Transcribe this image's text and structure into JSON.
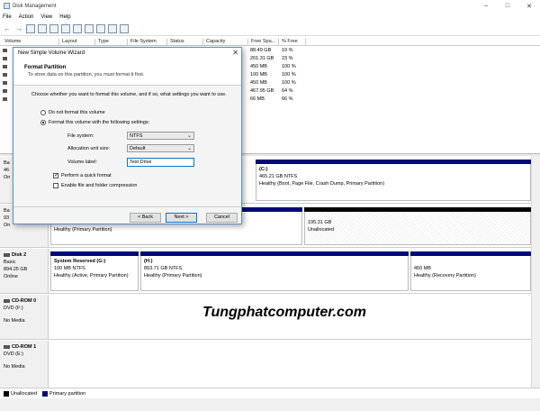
{
  "window": {
    "title": "Disk Management",
    "controls": [
      "–",
      "□",
      "✕"
    ]
  },
  "menu": [
    "File",
    "Action",
    "View",
    "Help"
  ],
  "toolbar": {
    "back_icon": "←",
    "forward_icon": "→"
  },
  "columns": [
    "Volume",
    "Layout",
    "Type",
    "File System",
    "Status",
    "Capacity",
    "Free Spa...",
    "% Free"
  ],
  "volume_rows": [
    {
      "free": "88.49 GB",
      "pct": "19 %"
    },
    {
      "free": "201.31 GB",
      "pct": "23 %"
    },
    {
      "free": "450 MB",
      "pct": "100 %"
    },
    {
      "free": "100 MB",
      "pct": "100 %"
    },
    {
      "free": "450 MB",
      "pct": "100 %"
    },
    {
      "free": "467.95 GB",
      "pct": "64 %"
    },
    {
      "free": "66 MB",
      "pct": "66 %"
    }
  ],
  "disks": {
    "disk0": {
      "label_lines": [
        "Ba",
        "46",
        "On"
      ],
      "part_c": {
        "title": "(C:)",
        "size": "465.21 GB NTFS",
        "status": "Healthy (Boot, Page File, Crash Dump, Primary Partition)"
      }
    },
    "disk1": {
      "label_lines": [
        "Ba",
        "93",
        "On"
      ],
      "part_a": {
        "status": "Healthy (Primary Partition)"
      },
      "part_unalloc": {
        "size": "195.31 GB",
        "status": "Unallocated"
      }
    },
    "disk2": {
      "name": "Disk 2",
      "type": "Basic",
      "size": "894.25 GB",
      "state": "Online",
      "part_sys": {
        "title": "System Reserved (G:)",
        "size": "100 MB NTFS",
        "status": "Healthy (Active, Primary Partition)"
      },
      "part_h": {
        "title": "(H:)",
        "size": "893.71 GB NTFS",
        "status": "Healthy (Primary Partition)"
      },
      "part_rec": {
        "size": "450 MB",
        "status": "Healthy (Recovery Partition)"
      }
    },
    "cdrom0": {
      "name": "CD-ROM 0",
      "drive": "DVD (F:)",
      "media": "No Media"
    },
    "cdrom1": {
      "name": "CD-ROM 1",
      "drive": "DVD (E:)",
      "media": "No Media"
    }
  },
  "watermark": "Tungphatcomputer.com",
  "legend": {
    "unallocated": "Unallocated",
    "primary": "Primary partition"
  },
  "colors": {
    "primary_partition": "#000a78",
    "unallocated": "#000000",
    "dialog_border": "#5b8ec8"
  },
  "dialog": {
    "title": "New Simple Volume Wizard",
    "close_icon": "✕",
    "heading": "Format Partition",
    "subheading": "To store data on this partition, you must format it first.",
    "prompt": "Choose whether you want to format this volume, and if so, what settings you want to use.",
    "radio_no_format": "Do not format this volume",
    "radio_format": "Format this volume with the following settings:",
    "file_system_label": "File system:",
    "file_system_value": "NTFS",
    "allocation_label": "Allocation unit size:",
    "allocation_value": "Default",
    "volume_label_label": "Volume label:",
    "volume_label_value": "Test Drive",
    "quick_format_label": "Perform a quick format",
    "compression_label": "Enable file and folder compression",
    "back_button": "< Back",
    "next_button": "Next >",
    "cancel_button": "Cancel"
  }
}
